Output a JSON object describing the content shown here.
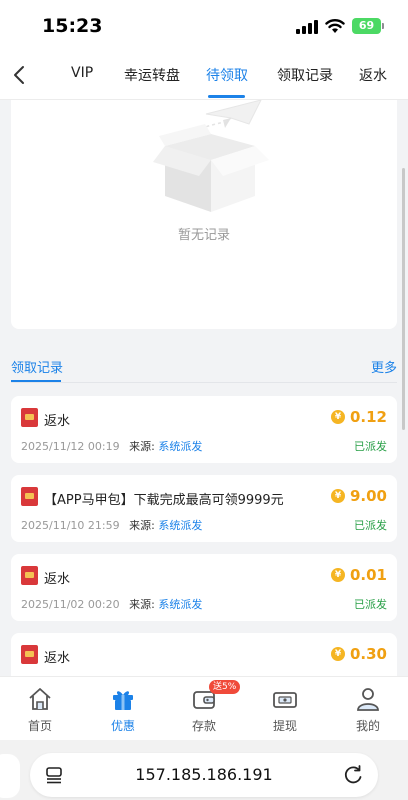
{
  "status_bar": {
    "time": "15:23",
    "battery": "69"
  },
  "tabs": [
    {
      "label": "VIP"
    },
    {
      "label": "幸运转盘"
    },
    {
      "label": "待领取"
    },
    {
      "label": "领取记录"
    },
    {
      "label": "返水"
    }
  ],
  "active_tab": "待领取",
  "empty_state": {
    "text": "暂无记录"
  },
  "section": {
    "title": "领取记录",
    "more": "更多"
  },
  "records": [
    {
      "title": "返水",
      "amount": "0.12",
      "time": "2025/11/12 00:19",
      "source_label": "来源:",
      "source": "系统派发",
      "status": "已派发"
    },
    {
      "title": "【APP马甲包】下载完成最高可领9999元",
      "amount": "9.00",
      "time": "2025/11/10 21:59",
      "source_label": "来源:",
      "source": "系统派发",
      "status": "已派发"
    },
    {
      "title": "返水",
      "amount": "0.01",
      "time": "2025/11/02 00:20",
      "source_label": "来源:",
      "source": "系统派发",
      "status": "已派发"
    },
    {
      "title": "返水",
      "amount": "0.30"
    }
  ],
  "coin_symbol": "¥",
  "bottom_nav": [
    {
      "label": "首页",
      "icon": "home-icon"
    },
    {
      "label": "优惠",
      "icon": "gift-icon"
    },
    {
      "label": "存款",
      "icon": "wallet-icon"
    },
    {
      "label": "提现",
      "icon": "withdraw-icon"
    },
    {
      "label": "我的",
      "icon": "user-icon"
    }
  ],
  "deposit_badge": "送5%",
  "browser": {
    "url": "157.185.186.191"
  },
  "colors": {
    "accent": "#1c82e8",
    "amount": "#f0a012",
    "status_done": "#2aa048",
    "badge": "#f04a3a"
  }
}
